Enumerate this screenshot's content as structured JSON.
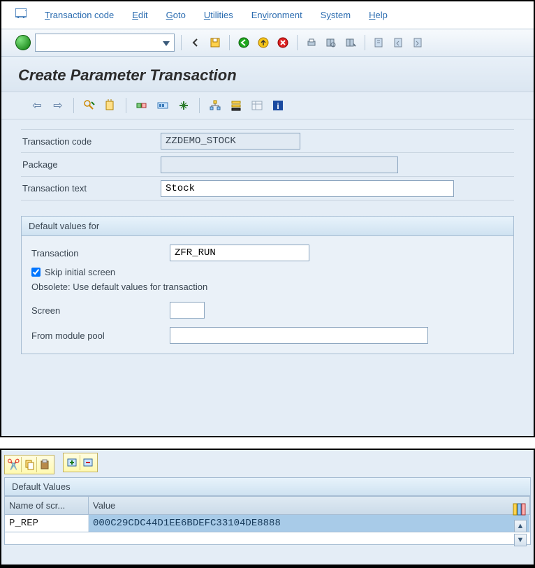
{
  "menu": {
    "items": [
      "Transaction code",
      "Edit",
      "Goto",
      "Utilities",
      "Environment",
      "System",
      "Help"
    ]
  },
  "title": "Create Parameter Transaction",
  "fields": {
    "tcode_label": "Transaction code",
    "tcode_value": "ZZDEMO_STOCK",
    "package_label": "Package",
    "package_value": "",
    "ttext_label": "Transaction text",
    "ttext_value": "Stock"
  },
  "group": {
    "title": "Default values for",
    "transaction_label": "Transaction",
    "transaction_value": "ZFR_RUN",
    "skip_label": "Skip initial screen",
    "skip_checked": true,
    "obsolete_text": "Obsolete: Use default values for transaction",
    "screen_label": "Screen",
    "screen_value": "",
    "module_label": "From module pool",
    "module_value": ""
  },
  "grid": {
    "title": "Default Values",
    "col1": "Name of scr...",
    "col2": "Value",
    "rows": [
      {
        "name": "P_REP",
        "value": "000C29CDC44D1EE6BDEFC33104DE8888"
      }
    ]
  }
}
